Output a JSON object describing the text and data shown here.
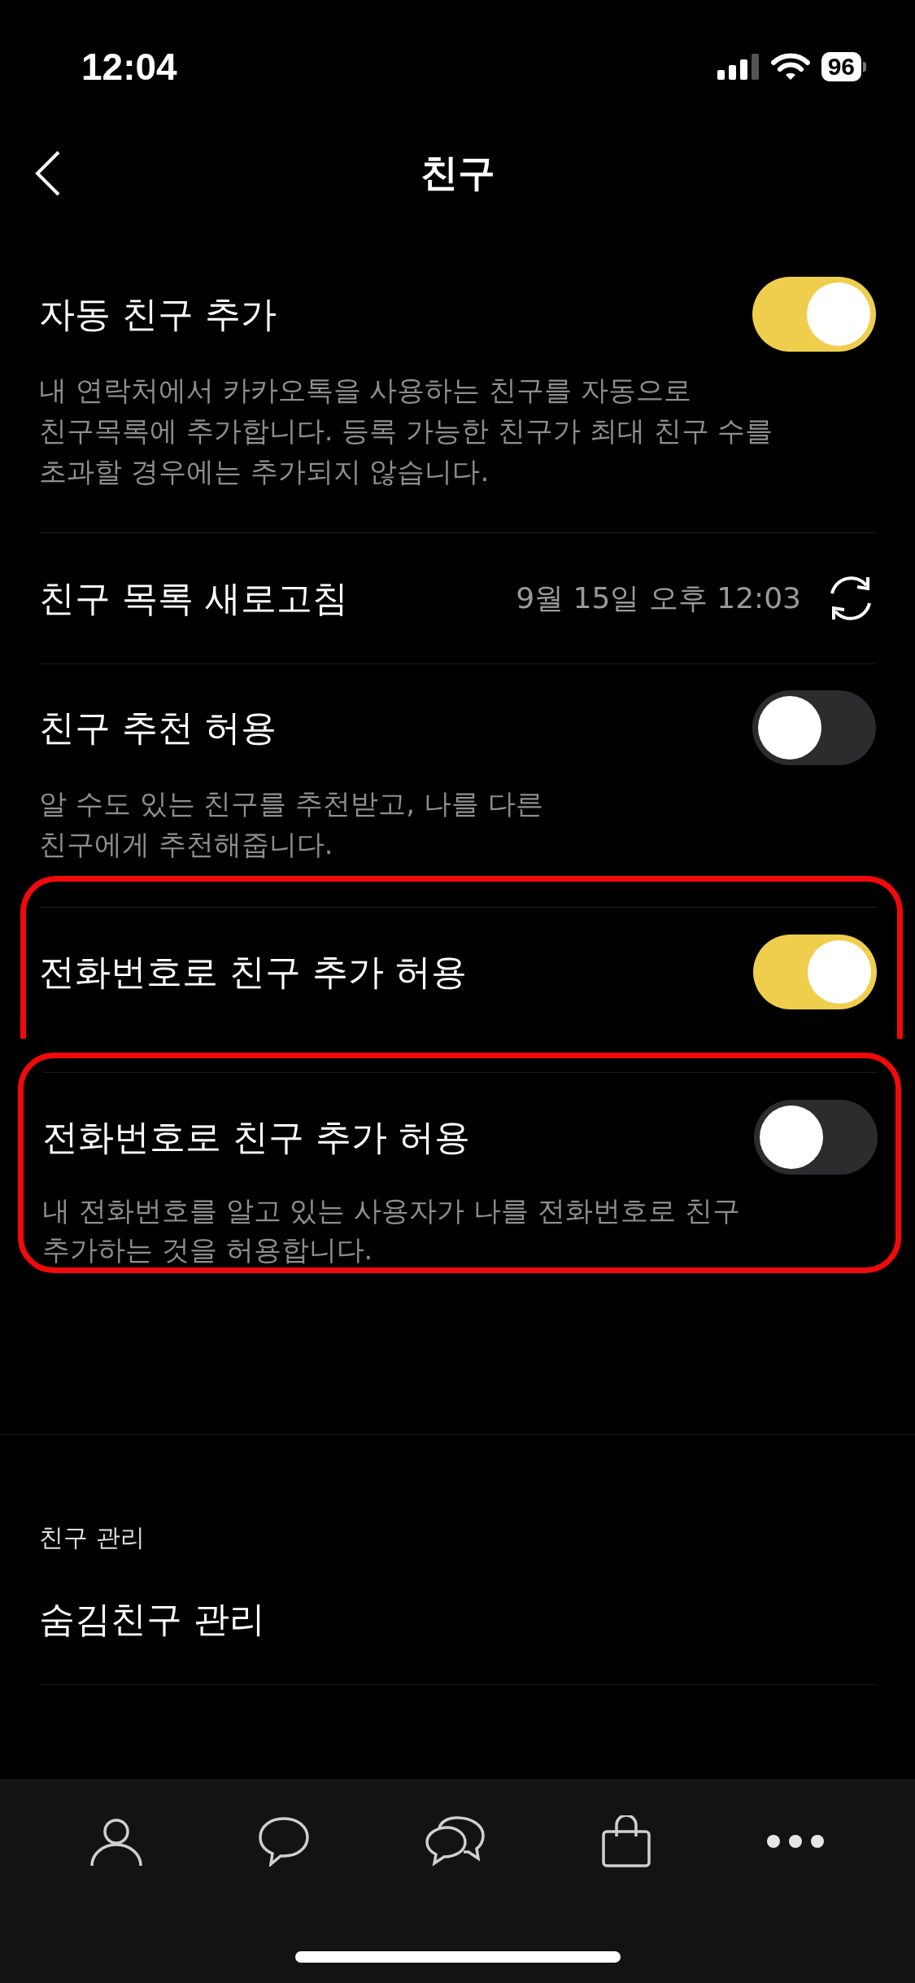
{
  "status_bar": {
    "time": "12:04",
    "battery": "96"
  },
  "nav": {
    "title": "친구"
  },
  "settings": [
    {
      "kind": "toggle",
      "title": "자동 친구 추가",
      "description": "내 연락처에서 카카오톡을 사용하는 친구를 자동으로\n친구목록에 추가합니다. 등록 가능한 친구가 최대 친구 수를\n초과할 경우에는 추가되지 않습니다.",
      "on": true
    },
    {
      "kind": "refresh",
      "title": "친구 목록 새로고침",
      "value": "9월 15일 오후 12:03"
    },
    {
      "kind": "toggle",
      "title": "친구 추천 허용",
      "description": "알 수도 있는 친구를 추천받고, 나를 다른\n친구에게 추천해줍니다.",
      "on": false
    }
  ],
  "highlighted": [
    {
      "title": "전화번호로 친구 추가 허용",
      "on": true
    },
    {
      "title": "전화번호로 친구 추가 허용",
      "description": "내 전화번호를 알고 있는 사용자가 나를 전화번호로 친구\n추가하는 것을 허용합니다.",
      "on": false
    }
  ],
  "section": {
    "header": "친구 관리",
    "items": [
      {
        "title": "숨김친구 관리"
      }
    ]
  },
  "tab_bar": {
    "tabs": [
      {
        "kind": "friends"
      },
      {
        "kind": "chats"
      },
      {
        "kind": "openchat"
      },
      {
        "kind": "shopping"
      },
      {
        "kind": "more"
      }
    ]
  }
}
